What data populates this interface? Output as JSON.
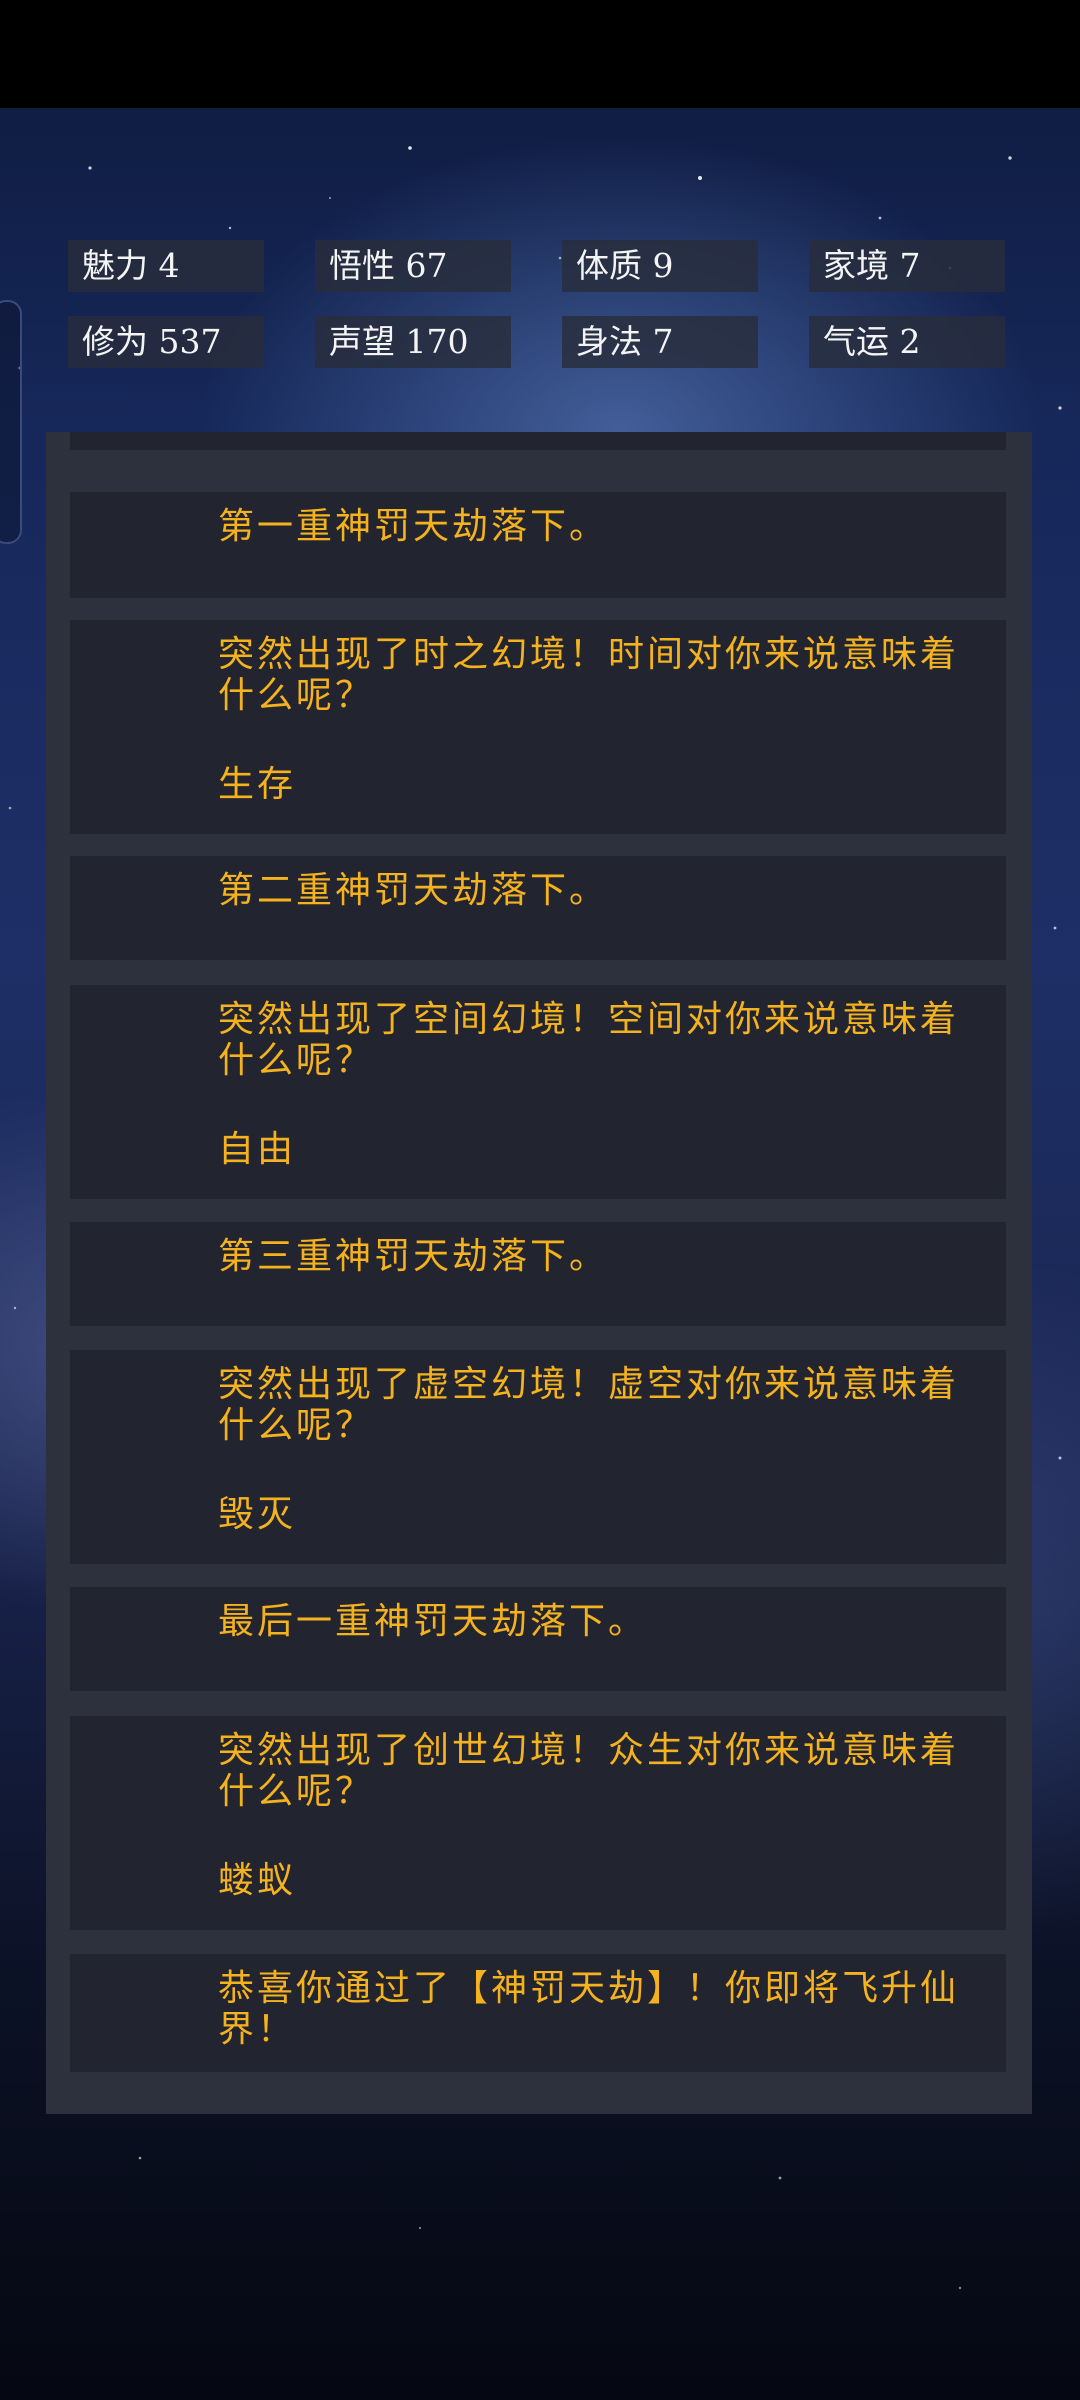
{
  "stats": [
    {
      "label": "魅力 4"
    },
    {
      "label": "悟性 67"
    },
    {
      "label": "体质 9"
    },
    {
      "label": "家境 7"
    },
    {
      "label": "修为 537"
    },
    {
      "label": "声望 170"
    },
    {
      "label": "身法 7"
    },
    {
      "label": "气运 2"
    }
  ],
  "log": [
    {
      "text": "第一重神罚天劫落下。"
    },
    {
      "text": "突然出现了时之幻境！时间对你来说意味着什么呢？",
      "choice": "生存"
    },
    {
      "text": "第二重神罚天劫落下。"
    },
    {
      "text": "突然出现了空间幻境！空间对你来说意味着什么呢？",
      "choice": "自由"
    },
    {
      "text": "第三重神罚天劫落下。"
    },
    {
      "text": "突然出现了虚空幻境！虚空对你来说意味着什么呢？",
      "choice": "毁灭"
    },
    {
      "text": "最后一重神罚天劫落下。"
    },
    {
      "text": "突然出现了创世幻境！众生对你来说意味着什么呢？",
      "choice": "蝼蚁"
    },
    {
      "text": "恭喜你通过了【神罚天劫】！你即将飞升仙界！"
    }
  ]
}
